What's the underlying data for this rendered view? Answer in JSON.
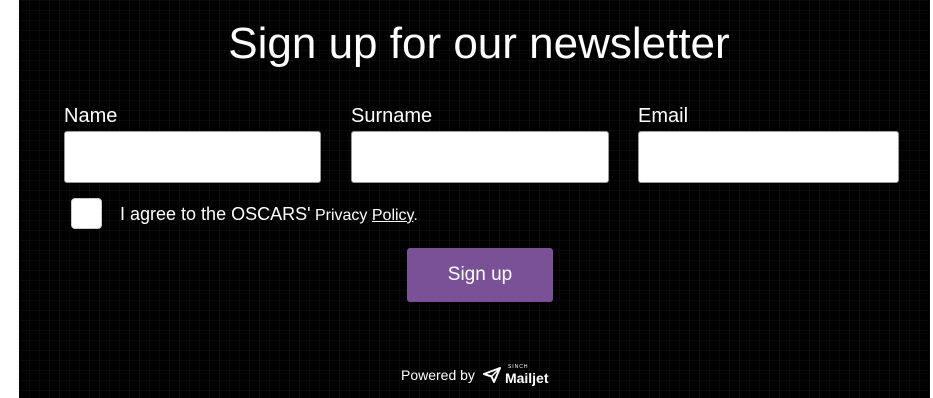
{
  "form": {
    "title": "Sign up for our newsletter",
    "fields": {
      "name": {
        "label": "Name",
        "value": "",
        "placeholder": ""
      },
      "surname": {
        "label": "Surname",
        "value": "",
        "placeholder": ""
      },
      "email": {
        "label": "Email",
        "value": "",
        "placeholder": ""
      }
    },
    "consent": {
      "text_main": "I agree to the OSCARS'",
      "text_privacy": " Privacy ",
      "link_text": "Policy",
      "text_end": ".",
      "checked": false
    },
    "submit_label": "Sign up"
  },
  "footer": {
    "powered_by": "Powered by",
    "brand_small": "SINCH",
    "brand_name": "Mailjet",
    "logo_icon": "paper-plane-icon"
  },
  "colors": {
    "background": "#000000",
    "button": "#7a5197",
    "text": "#ffffff",
    "input_bg": "#ffffff"
  }
}
